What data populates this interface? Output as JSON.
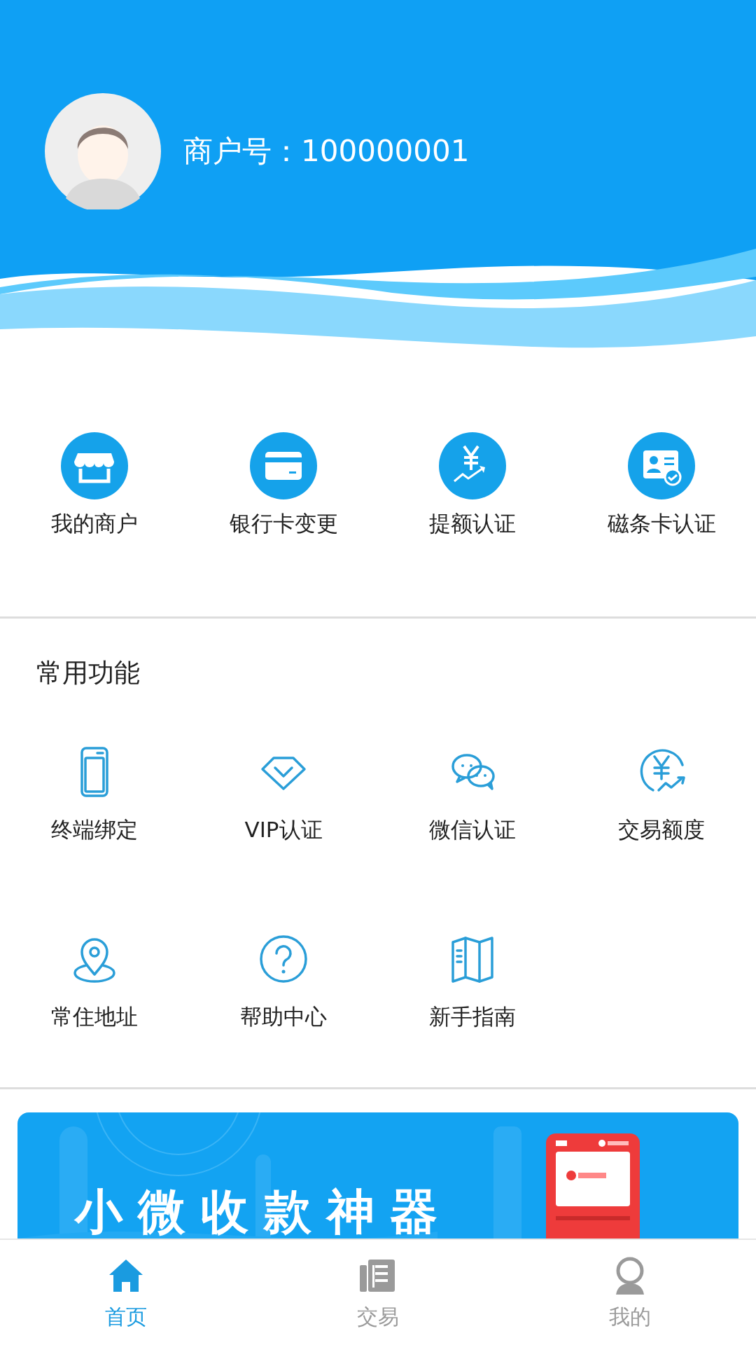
{
  "header": {
    "merchant_label": "商户号：100000001"
  },
  "shortcuts": [
    {
      "label": "我的商户"
    },
    {
      "label": "银行卡变更"
    },
    {
      "label": "提额认证"
    },
    {
      "label": "磁条卡认证"
    }
  ],
  "common_functions": {
    "title": "常用功能",
    "items": [
      {
        "label": "终端绑定"
      },
      {
        "label": "VIP认证"
      },
      {
        "label": "微信认证"
      },
      {
        "label": "交易额度"
      },
      {
        "label": "常住地址"
      },
      {
        "label": "帮助中心"
      },
      {
        "label": "新手指南"
      }
    ]
  },
  "banner": {
    "title": "小微收款神器"
  },
  "tabs": [
    {
      "label": "首页",
      "selected": true
    },
    {
      "label": "交易",
      "selected": false
    },
    {
      "label": "我的",
      "selected": false
    }
  ]
}
